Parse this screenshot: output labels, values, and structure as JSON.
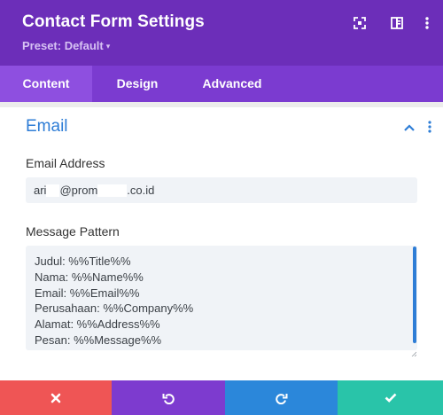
{
  "header": {
    "title": "Contact Form Settings",
    "preset_label": "Preset: Default",
    "background": "#6c2eb9",
    "icons": [
      "expand-icon",
      "sidebar-icon",
      "more-vertical-icon"
    ]
  },
  "tabs": [
    {
      "label": "Content",
      "active": true
    },
    {
      "label": "Design",
      "active": false
    },
    {
      "label": "Advanced",
      "active": false
    }
  ],
  "section": {
    "title": "Email",
    "accent": "#2e7dd6",
    "icons": [
      "chevron-up-icon",
      "more-vertical-icon"
    ]
  },
  "email_address": {
    "label": "Email Address",
    "value_part1": "ari",
    "value_part2": "@prom",
    "value_part3": ".co.id"
  },
  "message_pattern": {
    "label": "Message Pattern",
    "value": "Judul: %%Title%%\nNama: %%Name%%\nEmail: %%Email%%\nPerusahaan: %%Company%%\nAlamat: %%Address%%\nPesan: %%Message%%"
  },
  "footer": {
    "buttons": [
      {
        "name": "discard",
        "icon": "close-icon",
        "color": "#ef5555"
      },
      {
        "name": "undo",
        "icon": "undo-icon",
        "color": "#7d3bcf"
      },
      {
        "name": "redo",
        "icon": "redo-icon",
        "color": "#2b87da"
      },
      {
        "name": "save",
        "icon": "check-icon",
        "color": "#29c4a9"
      }
    ]
  }
}
